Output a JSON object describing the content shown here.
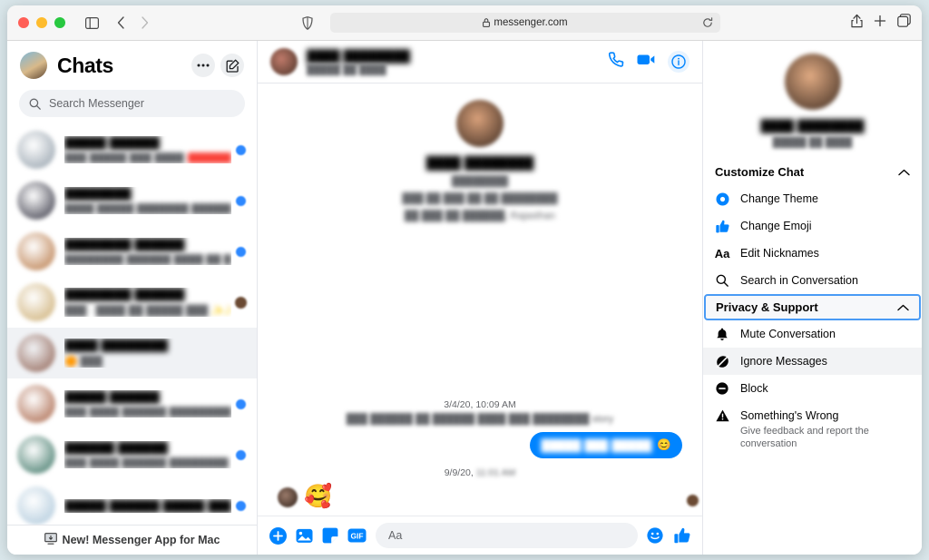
{
  "browser": {
    "url": "messenger.com",
    "icons": {
      "sidebar_toggle": "sidebar-toggle-icon",
      "back": "back-arrow-icon",
      "forward": "forward-arrow-icon",
      "shield": "privacy-shield-icon",
      "lock": "lock-icon",
      "reload": "reload-icon",
      "share": "share-icon",
      "new_tab": "plus-icon",
      "tabs": "tabs-overview-icon"
    }
  },
  "sidebar": {
    "title": "Chats",
    "more_label": "•••",
    "compose_label": "new-message",
    "search": {
      "placeholder": "Search Messenger",
      "value": ""
    },
    "banner": {
      "label": "New! Messenger App for Mac",
      "icon": "desktop-download-icon"
    },
    "chats": [
      {
        "name": "█████ ██████",
        "snippet": "███ █████ ███ ████",
        "highlight": "██████",
        "time": "██",
        "badge": "unread",
        "selected": false,
        "avatar": "#8d9aa6"
      },
      {
        "name": "████████",
        "snippet": "████ █████ ███████ ███████",
        "highlight": "",
        "time": "██",
        "badge": "unread",
        "selected": false,
        "avatar": "#2b2b3a"
      },
      {
        "name": "████████ ██████",
        "snippet": "████████ ██████ ████ ██ ███",
        "highlight": "",
        "time": "██",
        "badge": "unread",
        "selected": false,
        "avatar": "#b4713c"
      },
      {
        "name": "████████ ██████",
        "snippet": "███ · ████ ██ █████ ███ ✨✨✨",
        "highlight": "",
        "time": "███",
        "badge": "seen",
        "selected": false,
        "avatar": "#c9a86a"
      },
      {
        "name": "████ ████████",
        "snippet": "🟠 ███",
        "highlight": "",
        "time": "",
        "badge": "none",
        "selected": true,
        "avatar": "#8a5a4a"
      },
      {
        "name": "█████ ██████",
        "snippet": "███ ████ ██████ █████████ ███",
        "highlight": "",
        "time": "███",
        "badge": "unread",
        "selected": false,
        "avatar": "#a35a3b"
      },
      {
        "name": "██████ ██████",
        "snippet": "███ ████ ██████ ████████ ███",
        "highlight": "",
        "time": "███",
        "badge": "unread",
        "selected": false,
        "avatar": "#2e6b5a"
      },
      {
        "name": "█████ ██████ █████ ██████",
        "snippet": "",
        "highlight": "",
        "time": "",
        "badge": "unread",
        "selected": false,
        "avatar": "#a8c4d8"
      }
    ]
  },
  "conversation": {
    "header": {
      "name": "████ ████████",
      "status": "█████ ██ ████",
      "call_icon": "phone-icon",
      "video_icon": "video-camera-icon",
      "info_icon": "info-icon"
    },
    "intro": {
      "name": "████ ████████",
      "subtitle": "████████",
      "line1": "███ ██ ███ ██ ██ ████████",
      "line2": "██ ███ ██ ██████, Rajasthan"
    },
    "messages": [
      {
        "type": "timestamp",
        "text": "3/4/20, 10:09 AM"
      },
      {
        "type": "system",
        "text": "███ ██████ ██ ██████ ████ ███ ████████ story"
      },
      {
        "type": "sent",
        "text": "█████ ███ █████",
        "emoji": "😊"
      },
      {
        "type": "timestamp",
        "text": "9/9/20, ",
        "tail": "11:01 AM"
      },
      {
        "type": "received",
        "emoji": "🥰"
      }
    ],
    "composer": {
      "placeholder": "Aa",
      "value": "",
      "icons": {
        "add": "plus-circle-icon",
        "photo": "photo-icon",
        "sticker": "sticker-icon",
        "gif": "GIF",
        "emoji": "emoji-smiley-icon",
        "like": "thumbs-up-icon"
      }
    }
  },
  "details": {
    "profile": {
      "name": "████ ████████",
      "status": "█████ ██ ████"
    },
    "sections": [
      {
        "title": "Customize Chat",
        "expanded": true,
        "focused": false,
        "items": [
          {
            "label": "Change Theme",
            "icon": "theme-circle-icon",
            "sub": "",
            "hover": false
          },
          {
            "label": "Change Emoji",
            "icon": "thumbs-up-icon",
            "sub": "",
            "hover": false
          },
          {
            "label": "Edit Nicknames",
            "icon": "aa-text-icon",
            "sub": "",
            "hover": false
          },
          {
            "label": "Search in Conversation",
            "icon": "search-icon",
            "sub": "",
            "hover": false
          }
        ]
      },
      {
        "title": "Privacy & Support",
        "expanded": true,
        "focused": true,
        "items": [
          {
            "label": "Mute Conversation",
            "icon": "bell-icon",
            "sub": "",
            "hover": false
          },
          {
            "label": "Ignore Messages",
            "icon": "ignore-slash-icon",
            "sub": "",
            "hover": true
          },
          {
            "label": "Block",
            "icon": "block-icon",
            "sub": "",
            "hover": false
          },
          {
            "label": "Something's Wrong",
            "icon": "warning-triangle-icon",
            "sub": "Give feedback and report the conversation",
            "hover": false
          }
        ]
      }
    ]
  },
  "colors": {
    "accent": "#0084ff",
    "unread": "#2d88ff",
    "focus_ring": "#4a9bf5",
    "hover_bg": "#f2f3f5"
  }
}
